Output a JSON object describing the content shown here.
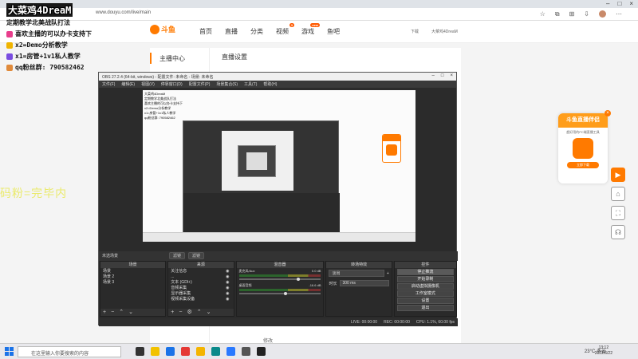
{
  "browser": {
    "url": "www.douyu.com/live/main",
    "user_label": "大菜鸡4DreaM"
  },
  "site": {
    "logo_text": "斗鱼",
    "logo_sub": "DOUYU.COM",
    "nav": [
      "首页",
      "直播",
      "分类",
      "视频",
      "游戏",
      "鱼吧"
    ],
    "nav_badges": {
      "video": "3",
      "games": "new"
    },
    "header_right": [
      "下载",
      "大菜鸡4DreaM"
    ],
    "left_menu_active": "主播中心",
    "tab_live": "直播设置",
    "edit_link": "修改"
  },
  "overlay": {
    "title": "大菜鸡4DreaM",
    "subtitle": "定期教学北美战队打法",
    "lines": [
      {
        "icon": "heart-icon",
        "text": "喜欢主播的可以办卡支持下",
        "color": "#e83e8c"
      },
      {
        "icon": "check-icon",
        "text": "x2=Demo分析教学",
        "color": "#f0b400"
      },
      {
        "icon": "gift-icon",
        "text": "x1=房管+1v1私人教学",
        "color": "#7a4de0"
      },
      {
        "icon": "person-icon",
        "text": "qq粉丝群: 790582462",
        "color": "#e08a3a"
      }
    ]
  },
  "yellow_text": "码粉=完毕内",
  "obs": {
    "title": "OBS 27.2.4 (64-bit, windows) - 配置文件: 未命名 - 场景: 未命名",
    "menu": [
      "文件(F)",
      "编辑(E)",
      "视图(V)",
      "停靠窗口(D)",
      "配置文件(P)",
      "场景集合(S)",
      "工具(T)",
      "帮助(H)"
    ],
    "scenebar_label": "未选场景",
    "scene_buttons": [
      "滤镜",
      "滤镜"
    ],
    "docks": {
      "scenes": {
        "title": "场景",
        "items": [
          "场景",
          "场景 2",
          "场景 3"
        ]
      },
      "sources": {
        "title": "来源",
        "items": [
          "关注信息",
          "...",
          "文本 (GDI+)",
          "音频采集",
          "显示器采集",
          "视频采集设备"
        ]
      },
      "mixer": {
        "title": "混音器",
        "channels": [
          {
            "name": "麦克风/Aux",
            "db": "0.0 dB",
            "level": 0.7
          },
          {
            "name": "桌面音频",
            "db": "-16.6 dB",
            "level": 0.55
          }
        ]
      },
      "transitions": {
        "title": "转场特效",
        "type": "淡出",
        "duration_label": "时长",
        "duration": "300 ms"
      },
      "controls": {
        "title": "控件",
        "buttons": [
          "停止推流",
          "开始录制",
          "启动虚拟摄像机",
          "工作室模式",
          "设置",
          "退出"
        ]
      }
    },
    "status": [
      "LIVE: 00:00:00",
      "REC: 00:00:00",
      "CPU: 1.1%, 60.00 fps"
    ]
  },
  "promo": {
    "title": "斗鱼直播伴侣",
    "subtitle": "超好用的PC端直播工具",
    "button": "立即下载"
  },
  "taskbar": {
    "search_placeholder": "在这里输入你要搜索的内容",
    "weather": "23°C 多云",
    "time": "13:12",
    "date": "2022/6/22"
  }
}
